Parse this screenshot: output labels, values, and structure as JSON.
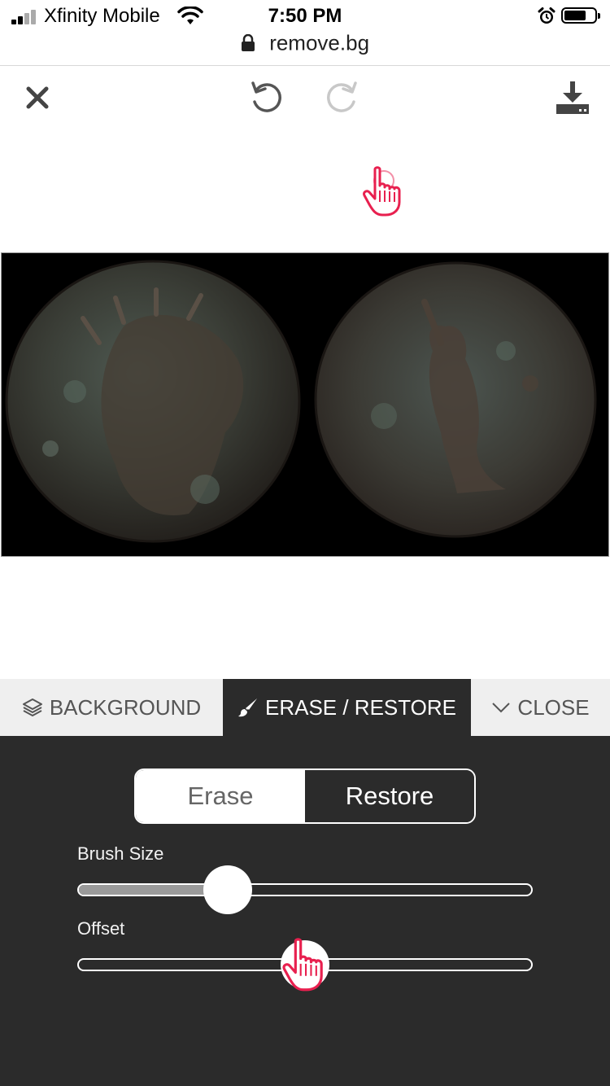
{
  "status_bar": {
    "carrier": "Xfinity Mobile",
    "time": "7:50 PM"
  },
  "browser": {
    "url": "remove.bg"
  },
  "toolbar": {
    "close_icon": "close-icon",
    "undo_icon": "undo-icon",
    "redo_icon": "redo-icon",
    "download_icon": "download-icon"
  },
  "tabs": [
    {
      "label": "BACKGROUND",
      "icon": "layers-icon"
    },
    {
      "label": "ERASE / RESTORE",
      "icon": "brush-icon"
    },
    {
      "label": "CLOSE",
      "icon": "chevron-down-icon"
    }
  ],
  "mode": {
    "erase_label": "Erase",
    "restore_label": "Restore",
    "selected": "Restore"
  },
  "sliders": {
    "brush_size": {
      "label": "Brush Size",
      "value_fraction": 0.33
    },
    "offset": {
      "label": "Offset",
      "value_fraction": 0.5
    }
  },
  "colors": {
    "panel": "#2b2b2b",
    "accent_hand": "#e8204f"
  }
}
